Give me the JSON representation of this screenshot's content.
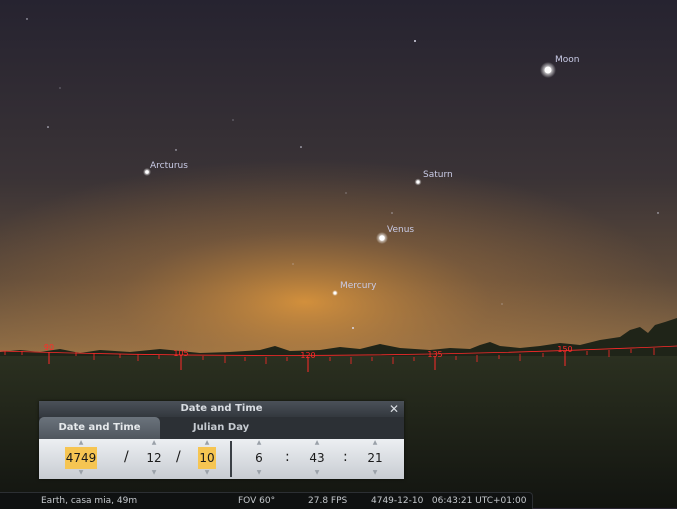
{
  "sky": {
    "objects": [
      {
        "name": "Moon",
        "label": "Moon"
      },
      {
        "name": "Arcturus",
        "label": "Arcturus"
      },
      {
        "name": "Saturn",
        "label": "Saturn"
      },
      {
        "name": "Venus",
        "label": "Venus"
      },
      {
        "name": "Mercury",
        "label": "Mercury"
      }
    ],
    "compass_ticks": [
      "90",
      "105",
      "120",
      "135",
      "150"
    ],
    "colors": {
      "grid": "#ff2a2a",
      "label": "#c9cbe6"
    }
  },
  "dialog": {
    "title": "Date and Time",
    "close_icon": "close-icon",
    "tabs": [
      "Date and Time",
      "Julian Day"
    ],
    "date": {
      "year": "4749",
      "month": "12",
      "day": "10",
      "sep": "/"
    },
    "time": {
      "hour": "6",
      "minute": "43",
      "second": "21",
      "sep": ":"
    }
  },
  "status": {
    "location": "Earth, casa mia, 49m",
    "fov": "FOV 60°",
    "fps": "27.8 FPS",
    "datetime": "4749-12-10   06:43:21 UTC+01:00"
  }
}
